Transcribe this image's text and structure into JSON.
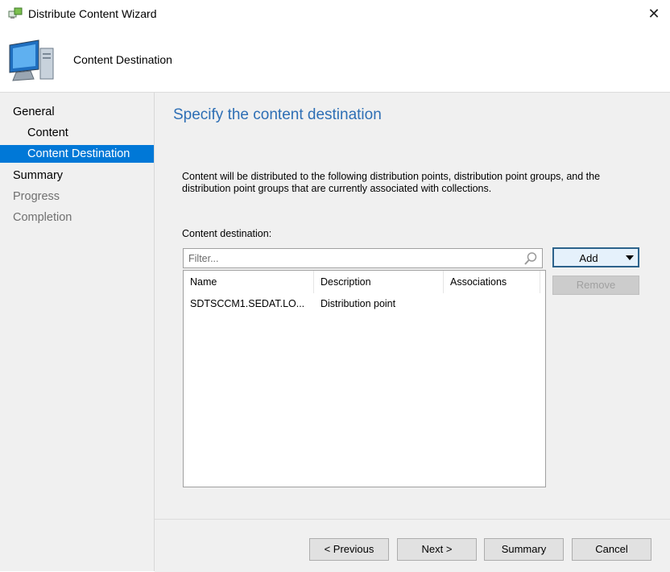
{
  "window": {
    "title": "Distribute Content Wizard",
    "close_label": "✕"
  },
  "header": {
    "title": "Content Destination"
  },
  "nav": {
    "items": [
      {
        "label": "General",
        "state": "normal"
      },
      {
        "label": "Content",
        "state": "normal"
      },
      {
        "label": "Content Destination",
        "state": "selected"
      },
      {
        "label": "Summary",
        "state": "normal"
      },
      {
        "label": "Progress",
        "state": "disabled"
      },
      {
        "label": "Completion",
        "state": "disabled"
      }
    ]
  },
  "main": {
    "title": "Specify the content destination",
    "description": "Content will be distributed to the following distribution points, distribution point groups, and the distribution point groups that are currently associated with collections.",
    "content_destination_label": "Content destination:",
    "filter": {
      "placeholder": "Filter...",
      "value": ""
    },
    "columns": [
      "Name",
      "Description",
      "Associations"
    ],
    "rows": [
      {
        "name": "SDTSCCM1.SEDAT.LO...",
        "description": "Distribution point",
        "associations": ""
      }
    ],
    "add_label": "Add",
    "remove_label": "Remove"
  },
  "footer": {
    "previous_label": "< Previous",
    "next_label": "Next >",
    "summary_label": "Summary",
    "cancel_label": "Cancel"
  },
  "colors": {
    "accent": "#0078d7",
    "title_blue": "#2e6fb5",
    "panel_bg": "#f0f0f0"
  },
  "icons": {
    "app": "wizard-app-icon",
    "header": "computer-icon",
    "search": "search-icon",
    "dropdown": "chevron-down-icon"
  }
}
